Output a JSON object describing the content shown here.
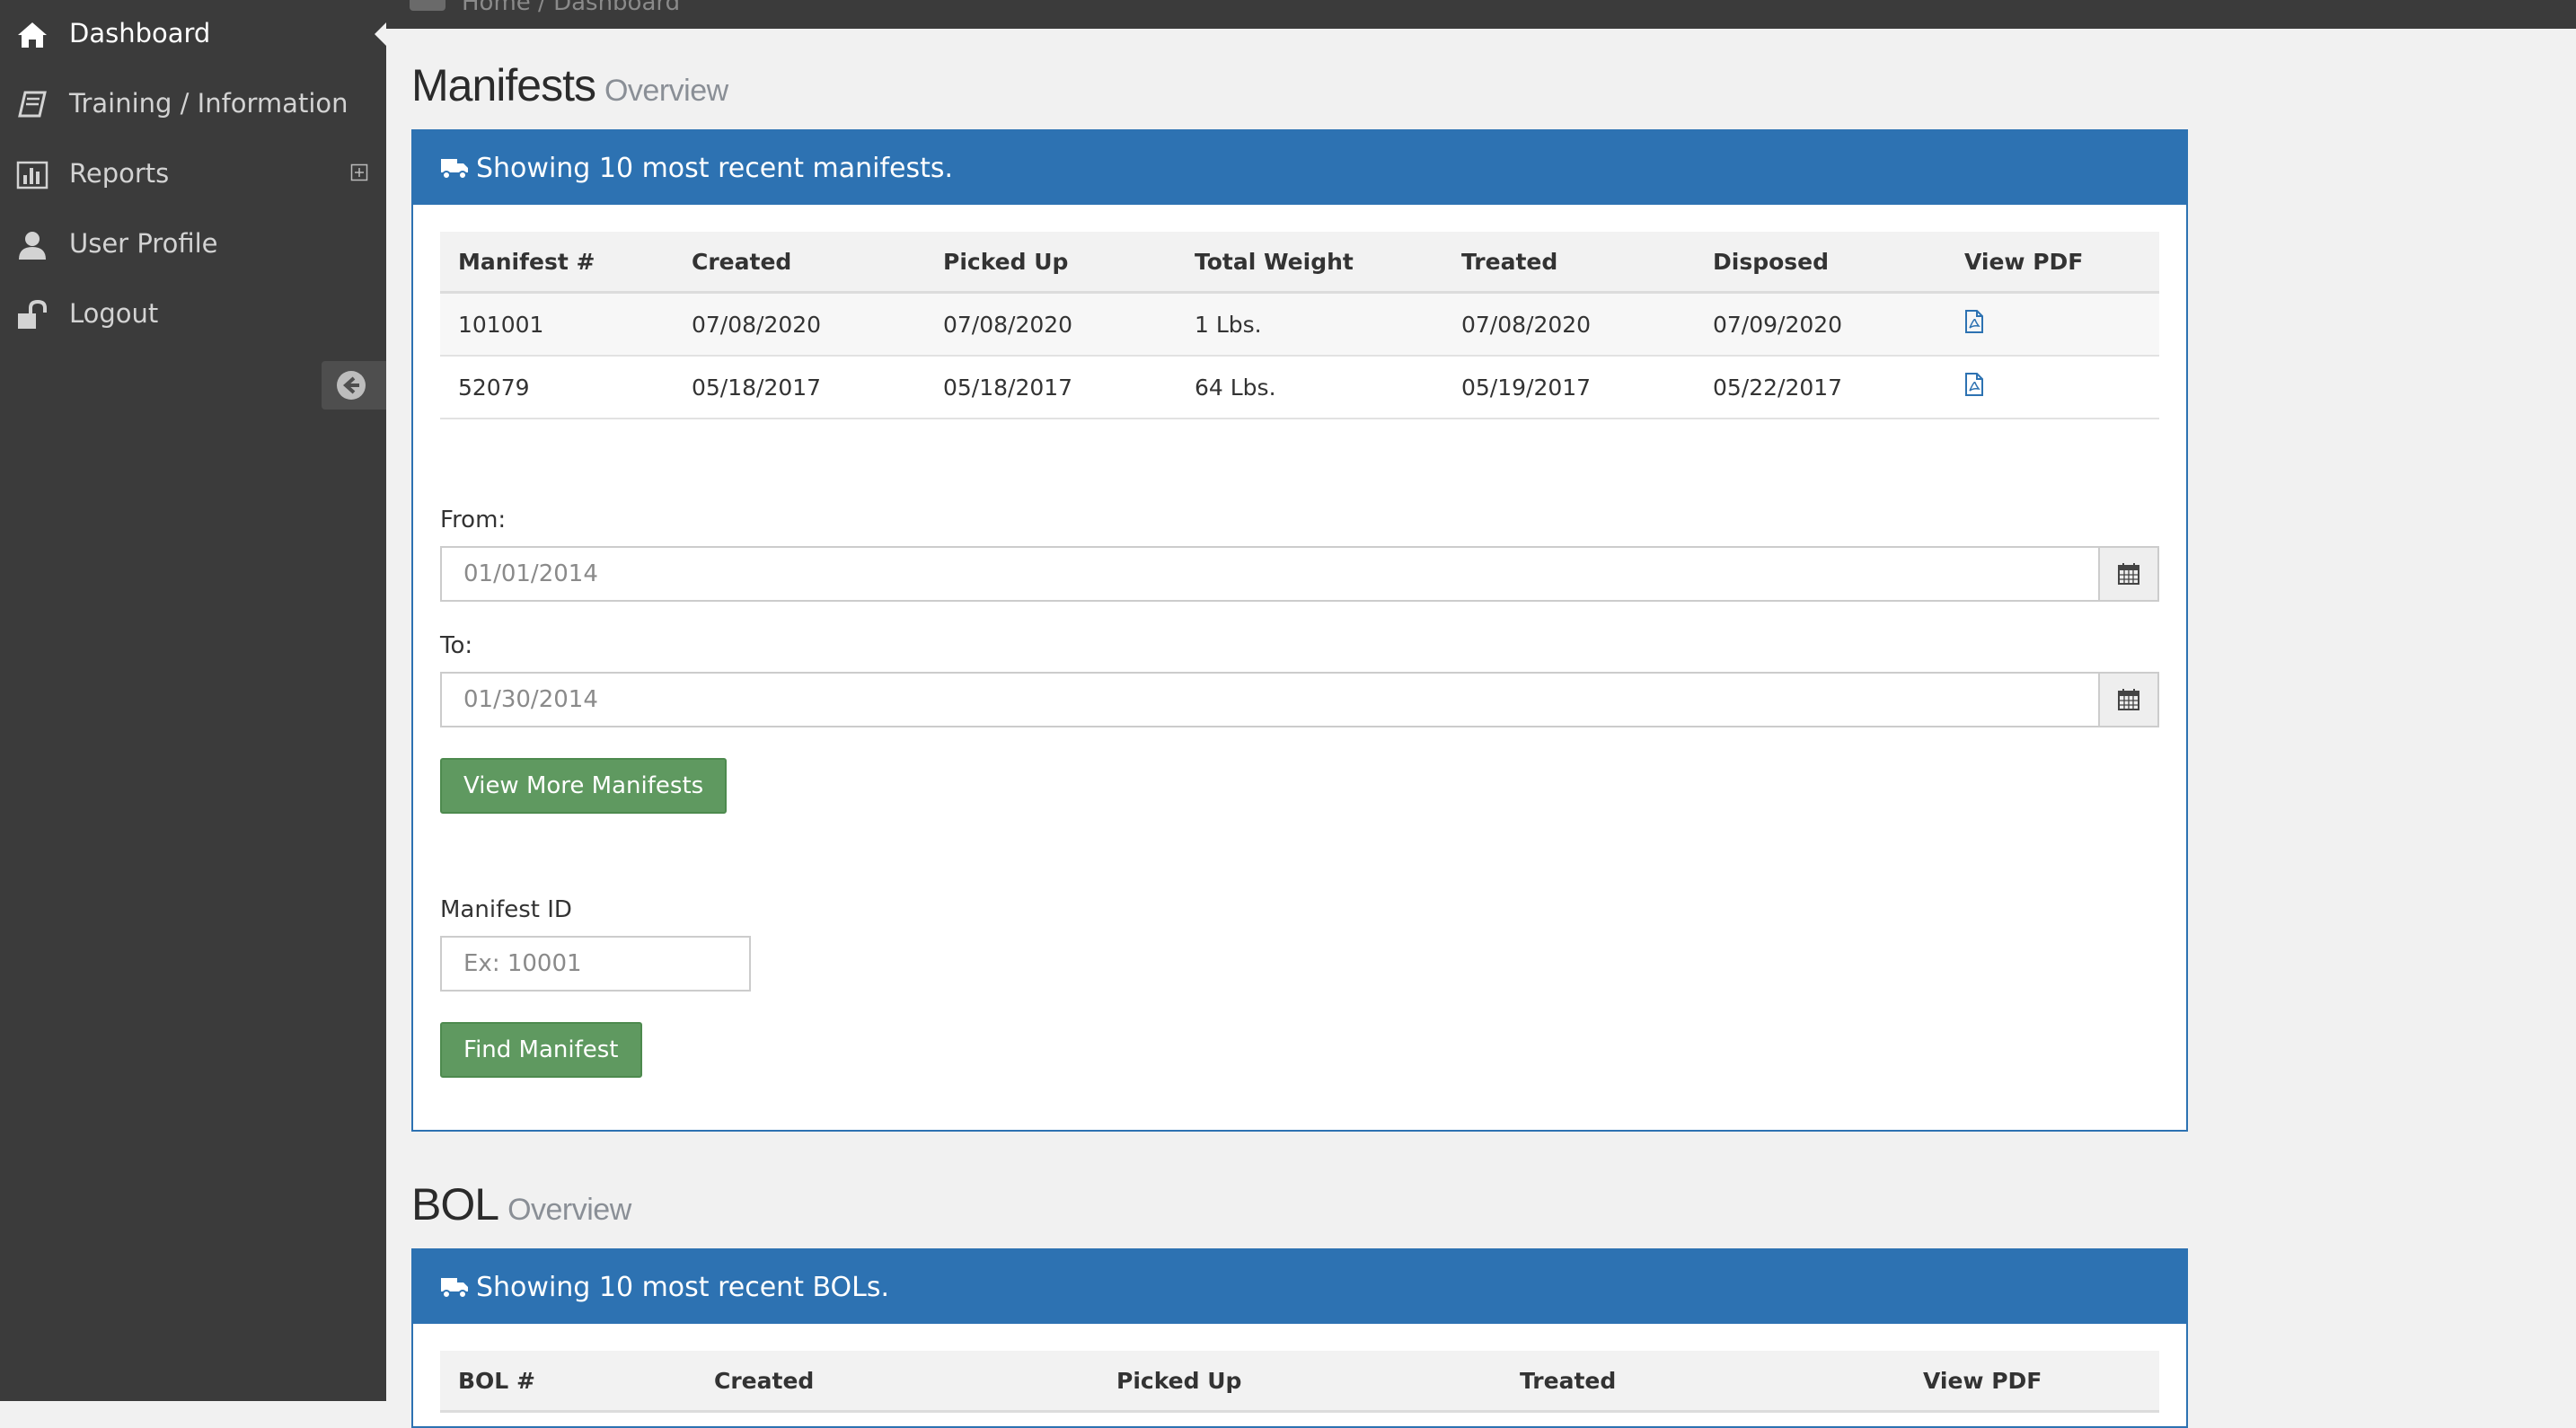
{
  "sidebar": {
    "items": [
      {
        "label": "Dashboard",
        "icon": "home-icon"
      },
      {
        "label": "Training / Information",
        "icon": "book-icon"
      },
      {
        "label": "Reports",
        "icon": "bar-chart-icon"
      },
      {
        "label": "User Profile",
        "icon": "user-icon"
      },
      {
        "label": "Logout",
        "icon": "unlock-icon"
      }
    ]
  },
  "topbar": {
    "breadcrumb": "Home / Dashboard"
  },
  "manifests": {
    "title": "Manifests",
    "subtitle": "Overview",
    "panel_heading": "Showing 10 most recent manifests.",
    "columns": [
      "Manifest #",
      "Created",
      "Picked Up",
      "Total Weight",
      "Treated",
      "Disposed",
      "View PDF"
    ],
    "rows": [
      [
        "101001",
        "07/08/2020",
        "07/08/2020",
        "1 Lbs.",
        "07/08/2020",
        "07/09/2020"
      ],
      [
        "52079",
        "05/18/2017",
        "05/18/2017",
        "64 Lbs.",
        "05/19/2017",
        "05/22/2017"
      ]
    ],
    "from_label": "From:",
    "from_placeholder": "01/01/2014",
    "to_label": "To:",
    "to_placeholder": "01/30/2014",
    "view_more_button": "View More Manifests",
    "id_label": "Manifest ID",
    "id_placeholder": "Ex: 10001",
    "find_button": "Find Manifest"
  },
  "bol": {
    "title": "BOL",
    "subtitle": "Overview",
    "panel_heading": "Showing 10 most recent BOLs.",
    "columns": [
      "BOL #",
      "Created",
      "Picked Up",
      "Treated",
      "View PDF"
    ]
  },
  "colors": {
    "sidebar_bg": "#3b3b3b",
    "panel_blue": "#2d72b2",
    "button_green": "#5f9960",
    "pdf_link_blue": "#2d72b2"
  }
}
